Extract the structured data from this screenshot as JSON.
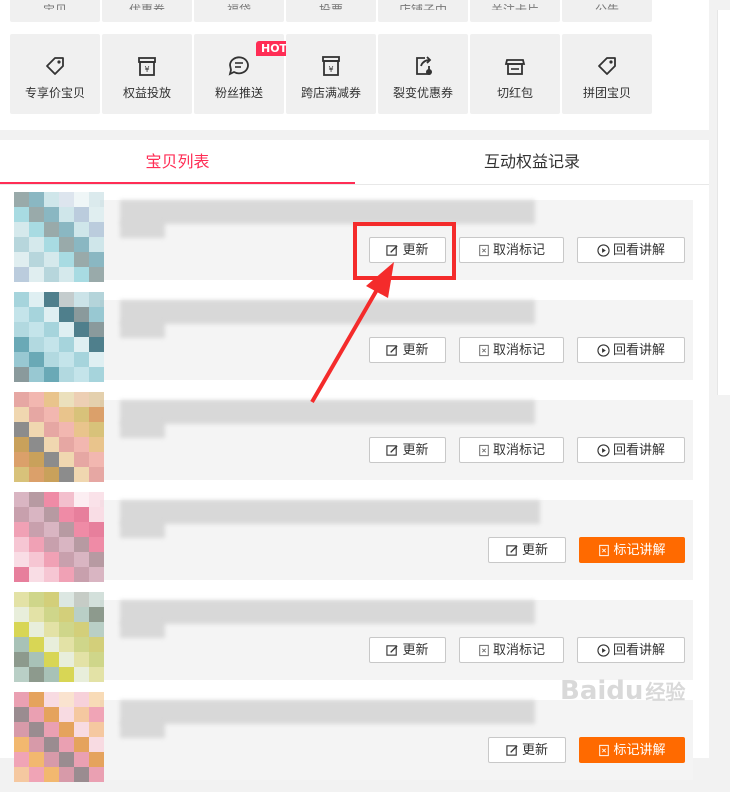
{
  "top_row_partial": [
    {
      "label": "宝贝"
    },
    {
      "label": "优惠券"
    },
    {
      "label": "福袋"
    },
    {
      "label": "投票"
    },
    {
      "label": "店铺子中"
    },
    {
      "label": "关注卡片"
    },
    {
      "label": "公告"
    }
  ],
  "tools": [
    {
      "label": "专享价宝贝",
      "icon": "tag-icon"
    },
    {
      "label": "权益投放",
      "icon": "gift-box-yen-icon"
    },
    {
      "label": "粉丝推送",
      "icon": "chat-bubble-icon",
      "badge": "HOT"
    },
    {
      "label": "跨店满减券",
      "icon": "box-yen-icon"
    },
    {
      "label": "裂变优惠券",
      "icon": "share-coupon-icon"
    },
    {
      "label": "切红包",
      "icon": "shop-icon"
    },
    {
      "label": "拼团宝贝",
      "icon": "tag-icon"
    }
  ],
  "tabs": [
    {
      "label": "宝贝列表",
      "active": true
    },
    {
      "label": "互动权益记录",
      "active": false
    }
  ],
  "items": [
    {
      "buttons": [
        "更新",
        "取消标记",
        "回看讲解"
      ],
      "marked": false
    },
    {
      "buttons": [
        "更新",
        "取消标记",
        "回看讲解"
      ],
      "marked": false
    },
    {
      "buttons": [
        "更新",
        "取消标记",
        "回看讲解"
      ],
      "marked": false
    },
    {
      "buttons": [
        "更新",
        "标记讲解"
      ],
      "marked": true
    },
    {
      "buttons": [
        "更新",
        "取消标记",
        "回看讲解"
      ],
      "marked": false
    },
    {
      "buttons": [
        "更新",
        "标记讲解"
      ],
      "marked": true
    }
  ],
  "colors": {
    "accent": "#ff2d55",
    "primary_button": "#ff6a00",
    "annotation": "#f42b2b"
  },
  "watermark": {
    "text": "Baidu",
    "suffix": "经验"
  }
}
